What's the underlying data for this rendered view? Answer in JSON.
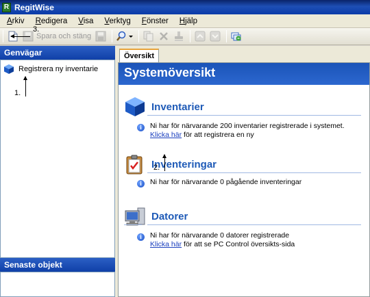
{
  "window": {
    "title": "RegitWise",
    "icon": "R"
  },
  "menu": [
    {
      "label": "Arkiv",
      "underline": "A",
      "rest": "rkiv"
    },
    {
      "label": "Redigera",
      "underline": "R",
      "rest": "edigera"
    },
    {
      "label": "Visa",
      "underline": "V",
      "rest": "isa"
    },
    {
      "label": "Verktyg",
      "underline": "V",
      "rest": "erktyg"
    },
    {
      "label": "Fönster",
      "underline": "F",
      "rest": "önster"
    },
    {
      "label": "Hjälp",
      "underline": "H",
      "rest": "jälp"
    }
  ],
  "toolbar": {
    "save_close_label": "Spara och stäng"
  },
  "sidebar": {
    "shortcuts_header": "Genvägar",
    "shortcuts": [
      {
        "label": "Registrera ny inventarie",
        "icon": "blue-cube-icon"
      }
    ],
    "recent_header": "Senaste objekt"
  },
  "main": {
    "tab_label": "Översikt",
    "page_title": "Systemöversikt",
    "sections": [
      {
        "title": "Inventarier",
        "icon": "blue-cube-icon",
        "line1": "Ni har för närvarande 200 inventarier registrerade i systemet.",
        "link": "Klicka här",
        "line2_rest": "för att registrera en ny"
      },
      {
        "title": "Inventeringar",
        "icon": "clipboard-check-icon",
        "line1": "Ni har för närvarande 0 pågående inventeringar"
      },
      {
        "title": "Datorer",
        "icon": "computer-icon",
        "line1": "Ni har för närvarande 0 datorer registrerade",
        "link": "Klicka här",
        "line2_rest": "för att se PC Control översikts-sida"
      }
    ]
  },
  "annotations": {
    "a1": "1.",
    "a2": "2.",
    "a3": "3."
  },
  "colors": {
    "accent_blue": "#1e5ab7",
    "header_blue": "#1b54b8",
    "link": "#1a3fbe"
  }
}
